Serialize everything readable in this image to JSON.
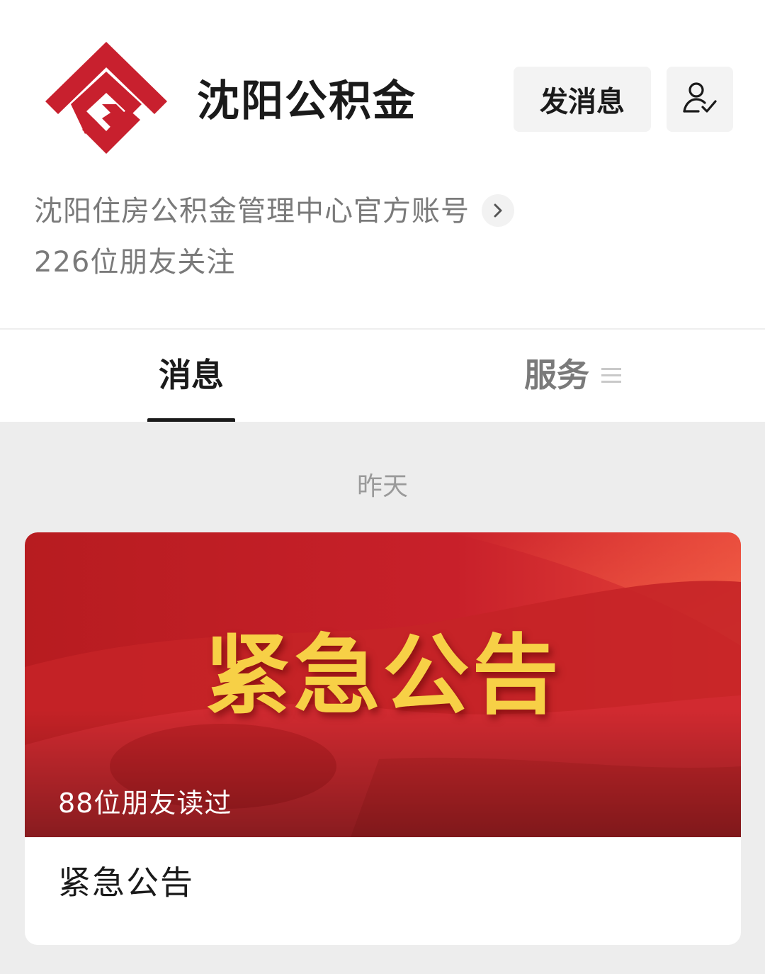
{
  "account": {
    "name": "沈阳公积金",
    "description": "沈阳住房公积金管理中心官方账号",
    "followers": "226位朋友关注",
    "brand_color": "#c8202e"
  },
  "actions": {
    "message_label": "发消息",
    "follow_icon": "person-check-icon"
  },
  "tabs": [
    {
      "label": "消息",
      "active": true
    },
    {
      "label": "服务",
      "active": false,
      "icon": "menu-lines-icon"
    }
  ],
  "feed": {
    "date_label": "昨天",
    "articles": [
      {
        "banner_text": "紧急公告",
        "read_count": "88位朋友读过",
        "title": "紧急公告",
        "banner_color": "#c41e24",
        "banner_text_color": "#f7d046"
      }
    ]
  }
}
